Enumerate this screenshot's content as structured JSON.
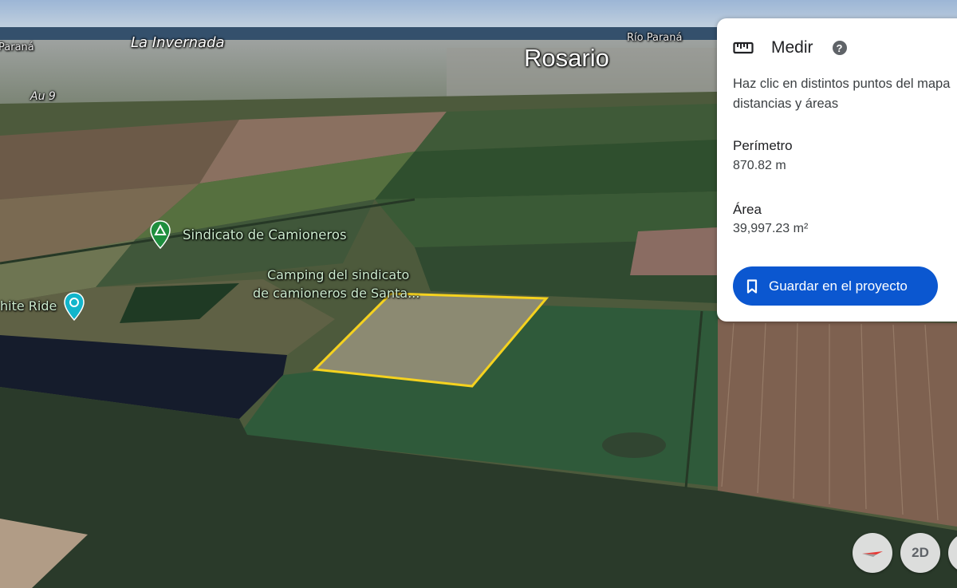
{
  "map": {
    "labels": {
      "la_invernada": "La Invernada",
      "rosario": "Rosario",
      "rio_parana_right": "Río Paraná",
      "rio_parana_left": "Paraná",
      "au9": "Au 9",
      "sindicato": "Sindicato de Camioneros",
      "camping_line1": "Camping del sindicato",
      "camping_line2": "de camioneros de Santa...",
      "white_ride": "hite Ride"
    },
    "pins": [
      {
        "name": "campground-pin",
        "color": "#1e8e3e"
      },
      {
        "name": "attraction-pin",
        "color": "#12b5cb"
      }
    ],
    "measurement_outline_color": "#f5d21f"
  },
  "panel": {
    "icon": "ruler-icon",
    "title": "Medir",
    "help_icon": "help-icon",
    "help_glyph": "?",
    "description_line1": "Haz clic en distintos puntos del mapa",
    "description_line2": "distancias y áreas",
    "perimeter_label": "Perímetro",
    "perimeter_value": "870.82 m",
    "area_label": "Área",
    "area_value": "39,997.23 m²",
    "save_label": "Guardar en el proyecto",
    "save_icon": "bookmark-icon"
  },
  "controls": {
    "compass_icon": "compass-icon",
    "view_toggle_label": "2D"
  }
}
